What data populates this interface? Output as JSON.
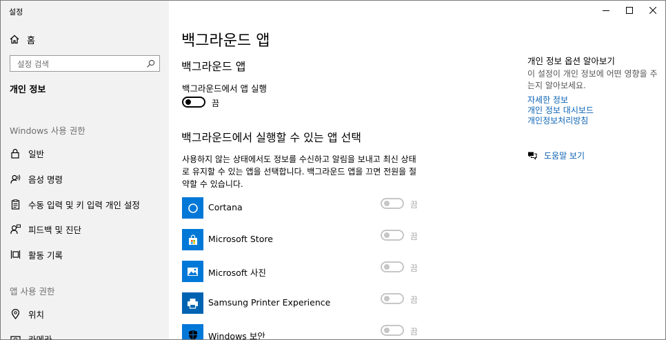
{
  "window": {
    "title": "설정"
  },
  "sidebar": {
    "home_label": "홈",
    "search_placeholder": "설정 검색",
    "current_section": "개인 정보",
    "windows_permissions_header": "Windows 사용 권한",
    "windows_items": [
      {
        "label": "일반",
        "icon": "lock-icon"
      },
      {
        "label": "음성 명령",
        "icon": "speech-icon"
      },
      {
        "label": "수동 입력 및 키 입력 개인 설정",
        "icon": "clipboard-icon"
      },
      {
        "label": "피드백 및 진단",
        "icon": "feedback-person-icon"
      },
      {
        "label": "활동 기록",
        "icon": "activity-history-icon"
      }
    ],
    "app_permissions_header": "앱 사용 권한",
    "app_items": [
      {
        "label": "위치",
        "icon": "location-icon"
      },
      {
        "label": "카메라",
        "icon": "camera-icon"
      }
    ]
  },
  "main": {
    "page_title": "백그라운드 앱",
    "section_title": "백그라운드 앱",
    "master_toggle_label": "백그라운드에서 앱 실행",
    "master_toggle_state": "끔",
    "choose_title": "백그라운드에서 실행할 수 있는 앱 선택",
    "description": "사용하지 않는 상태에서도 정보를 수신하고 알림을 보내고 최신 상태로 유지할 수 있는 앱을 선택합니다. 백그라운드 앱을 끄면 전원을 절약할 수 있습니다.",
    "apps": [
      {
        "name": "Cortana",
        "state": "끔",
        "tile_color": "#0078d7",
        "icon": "cortana-icon"
      },
      {
        "name": "Microsoft Store",
        "state": "끔",
        "tile_color": "#0078d7",
        "icon": "store-bag-icon"
      },
      {
        "name": "Microsoft 사진",
        "state": "끔",
        "tile_color": "#0078d7",
        "icon": "photos-icon"
      },
      {
        "name": "Samsung Printer Experience",
        "state": "끔",
        "tile_color": "#0063b1",
        "icon": "printer-icon"
      },
      {
        "name": "Windows 보안",
        "state": "끔",
        "tile_color": "#0078d7",
        "icon": "shield-icon"
      }
    ]
  },
  "right_panel": {
    "title": "개인 정보 옵션 알아보기",
    "description": "이 설정이 개인 정보에 어떤 영향을 주는지 알아보세요.",
    "links": [
      "자세한 정보",
      "개인 정보 대시보드",
      "개인정보처리방침"
    ],
    "help_label": "도움말 보기"
  },
  "colors": {
    "sidebar_bg": "#f2f2f2",
    "accent_tile": "#0078d7",
    "link": "#0a62b4"
  }
}
